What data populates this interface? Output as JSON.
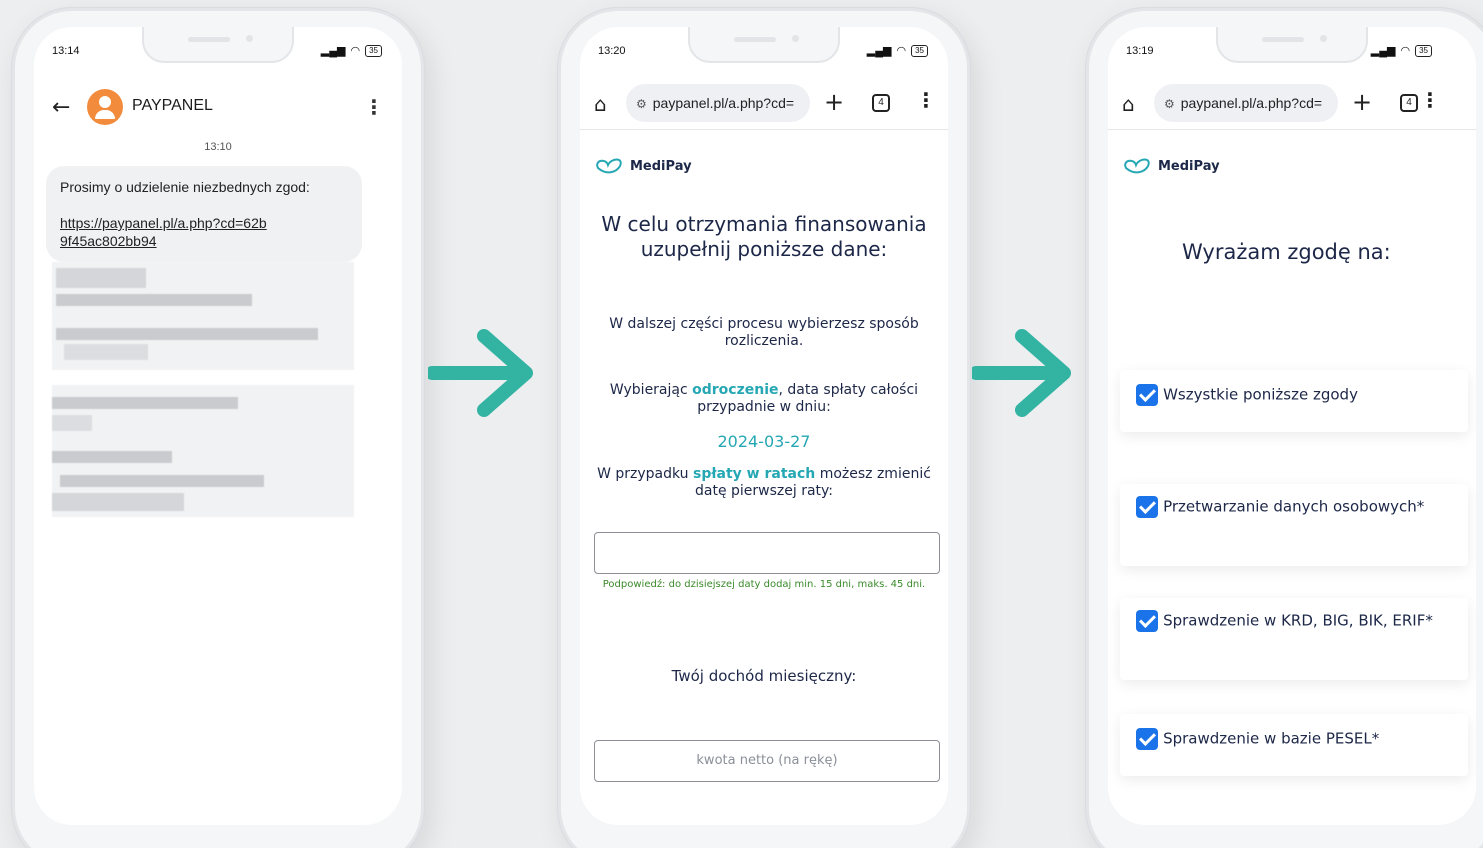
{
  "phone1": {
    "status_time": "13:14",
    "battery": "35",
    "sender": "PAYPANEL",
    "message_time": "13:10",
    "message_text": "Prosimy o udzielenie niezbednych zgod:",
    "message_link": "https://paypanel.pl/a.php?cd=62b9f45ac802bb94"
  },
  "phone2": {
    "status_time": "13:20",
    "battery": "35",
    "url": "paypanel.pl/a.php?cd=",
    "tab_count": "4",
    "logo": "MediPay",
    "heading": "W celu otrzymania finansowania uzupełnij poniższe dane:",
    "para1": "W dalszej części procesu wybierzesz sposób rozliczenia.",
    "para2_before": "Wybierając ",
    "para2_highlight": "odroczenie",
    "para2_after": ", data spłaty całości przypadnie w dniu:",
    "date": "2024-03-27",
    "para3_before": "W przypadku ",
    "para3_highlight": "spłaty w ratach",
    "para3_after": " możesz zmienić datę pierwszej raty:",
    "hint": "Podpowiedź: do dzisiejszej daty dodaj min. 15 dni, maks. 45 dni.",
    "income_label": "Twój dochód miesięczny:",
    "income_placeholder": "kwota netto (na rękę)"
  },
  "phone3": {
    "status_time": "13:19",
    "battery": "35",
    "url": "paypanel.pl/a.php?cd=",
    "tab_count": "4",
    "logo": "MediPay",
    "heading": "Wyrażam zgodę na:",
    "consents": [
      {
        "label": "Wszystkie poniższe zgody",
        "checked": true
      },
      {
        "label": "Przetwarzanie danych osobowych*",
        "checked": true
      },
      {
        "label": "Sprawdzenie w KRD, BIG, BIK, ERIF*",
        "checked": true
      },
      {
        "label": "Sprawdzenie w bazie PESEL*",
        "checked": true
      }
    ]
  },
  "colors": {
    "accent": "#25a7b4",
    "navy": "#1d2748",
    "arrow": "#33b3a2",
    "checkbox": "#1a73e8",
    "avatar": "#f28b3c"
  }
}
